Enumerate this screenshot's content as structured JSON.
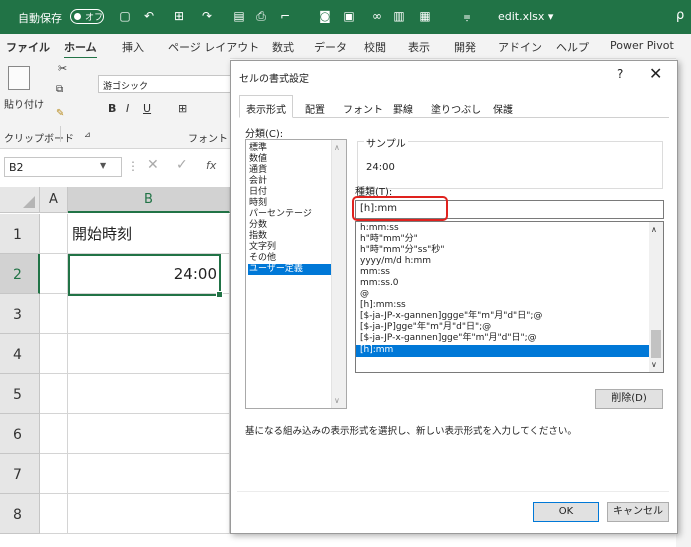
{
  "titlebar": {
    "autosave_label": "自動保存",
    "autosave_state": "オフ",
    "filename": "edit.xlsx ▾",
    "search_glyph": "ρ"
  },
  "ribbon_tabs": [
    "ファイル",
    "ホーム",
    "挿入",
    "ページ レイアウト",
    "数式",
    "データ",
    "校閲",
    "表示",
    "開発",
    "アドイン",
    "ヘルプ",
    "Power Pivot"
  ],
  "ribbon": {
    "paste_label": "貼り付け",
    "clipboard_group": "クリップボード",
    "font_name": "游ゴシック",
    "font_group": "フォント",
    "bold": "B",
    "italic": "I",
    "underline": "U"
  },
  "formula_bar": {
    "name_box": "B2",
    "fx": "fx"
  },
  "sheet": {
    "columns": [
      "A",
      "B"
    ],
    "rows": [
      "1",
      "2",
      "3",
      "4",
      "5",
      "6",
      "7",
      "8"
    ],
    "cell_B1": "開始時刻",
    "cell_B2": "24:00"
  },
  "dialog": {
    "title": "セルの書式設定",
    "help": "?",
    "close": "✕",
    "tabs": [
      "表示形式",
      "配置",
      "フォント",
      "罫線",
      "塗りつぶし",
      "保護"
    ],
    "category_label": "分類(C):",
    "categories": [
      "標準",
      "数値",
      "通貨",
      "会計",
      "日付",
      "時刻",
      "パーセンテージ",
      "分数",
      "指数",
      "文字列",
      "その他",
      "ユーザー定義"
    ],
    "selected_category": "ユーザー定義",
    "sample_label": "サンプル",
    "sample_value": "24:00",
    "type_label": "種類(T):",
    "type_value": "[h]:mm",
    "formats": [
      "h:mm:ss",
      "h\"時\"mm\"分\"",
      "h\"時\"mm\"分\"ss\"秒\"",
      "yyyy/m/d h:mm",
      "mm:ss",
      "mm:ss.0",
      "@",
      "[h]:mm:ss",
      "[$-ja-JP-x-gannen]ggge\"年\"m\"月\"d\"日\";@",
      "[$-ja-JP]gge\"年\"m\"月\"d\"日\";@",
      "[$-ja-JP-x-gannen]gge\"年\"m\"月\"d\"日\";@",
      "[h]:mm"
    ],
    "selected_format": "[h]:mm",
    "delete_button": "削除(D)",
    "description": "基になる組み込みの表示形式を選択し、新しい表示形式を入力してください。",
    "ok_button": "OK",
    "cancel_button": "キャンセル"
  },
  "colors": {
    "excel_green": "#217346",
    "selection_blue": "#0078d7",
    "highlight_red": "#e0221e"
  }
}
